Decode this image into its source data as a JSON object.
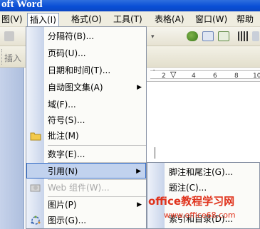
{
  "window": {
    "title": "oft Word"
  },
  "menubar": {
    "items": [
      {
        "label": "图(V)"
      },
      {
        "label": "插入(I)"
      },
      {
        "label": "格式(O)"
      },
      {
        "label": "工具(T)"
      },
      {
        "label": "表格(A)"
      },
      {
        "label": "窗口(W)"
      },
      {
        "label": "帮助"
      }
    ]
  },
  "toolbar2": {
    "insert_label": "插入"
  },
  "ruler": {
    "ticks": [
      "2",
      "4",
      "6",
      "8",
      "10"
    ]
  },
  "insert_menu": {
    "items": [
      {
        "label": "分隔符(B)...",
        "icon": ""
      },
      {
        "label": "页码(U)...",
        "icon": ""
      },
      {
        "label": "日期和时间(T)...",
        "icon": ""
      },
      {
        "label": "自动图文集(A)",
        "icon": "",
        "submenu": true
      },
      {
        "label": "域(F)...",
        "icon": ""
      },
      {
        "label": "符号(S)...",
        "icon": ""
      },
      {
        "label": "批注(M)",
        "icon": "folder-icon"
      },
      {
        "label": "数字(E)...",
        "icon": ""
      },
      {
        "label": "引用(N)",
        "icon": "",
        "submenu": true,
        "highlighted": true
      },
      {
        "label": "Web 组件(W)...",
        "icon": "web-component-icon",
        "disabled": true
      },
      {
        "label": "图片(P)",
        "icon": "",
        "submenu": true
      },
      {
        "label": "图示(G)...",
        "icon": "diagram-icon"
      }
    ]
  },
  "reference_submenu": {
    "items": [
      {
        "label": "脚注和尾注(G)..."
      },
      {
        "label": "题注(C)..."
      },
      {
        "label": "索引和目录(D)..."
      }
    ]
  },
  "watermark": {
    "line1": "office教程学习网",
    "line2": "www.office68.com"
  },
  "colors": {
    "title_bar": "#0a4fd6",
    "menu_highlight": "#c1d2ee",
    "menu_highlight_border": "#316ac5",
    "watermark": "#e0321b"
  }
}
